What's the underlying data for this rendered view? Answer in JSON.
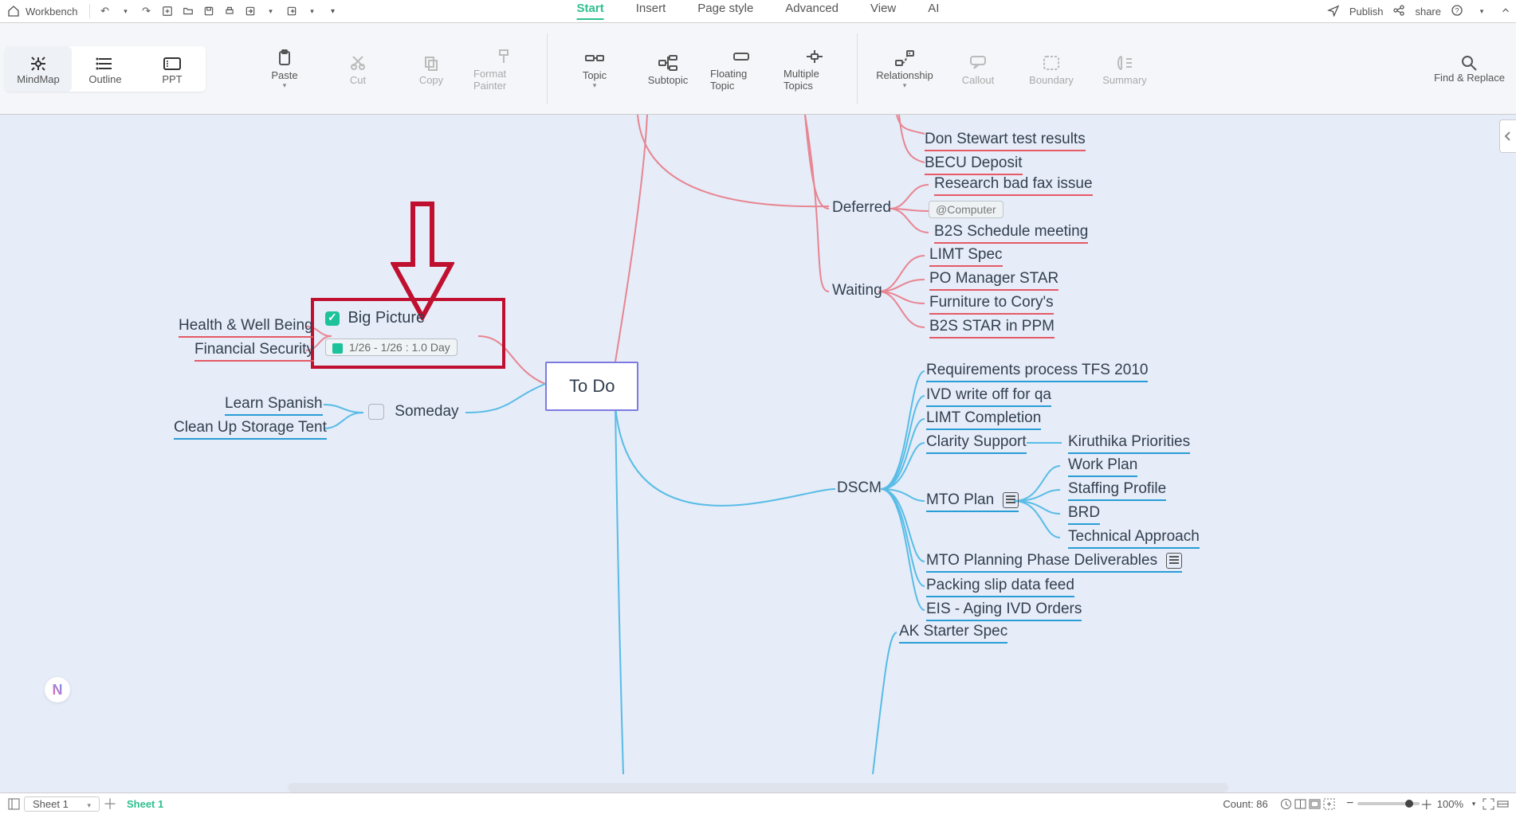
{
  "top": {
    "workbench": "Workbench",
    "menus": [
      "Start",
      "Insert",
      "Page style",
      "Advanced",
      "View",
      "AI"
    ],
    "active_menu": 0,
    "publish": "Publish",
    "share": "share"
  },
  "ribbon": {
    "views": [
      {
        "label": "MindMap",
        "active": true
      },
      {
        "label": "Outline",
        "active": false
      },
      {
        "label": "PPT",
        "active": false
      }
    ],
    "buttons": {
      "paste": "Paste",
      "cut": "Cut",
      "copy": "Copy",
      "format_painter": "Format Painter",
      "topic": "Topic",
      "subtopic": "Subtopic",
      "floating": "Floating Topic",
      "multiple": "Multiple Topics",
      "relationship": "Relationship",
      "callout": "Callout",
      "boundary": "Boundary",
      "summary": "Summary",
      "find_replace": "Find & Replace"
    }
  },
  "central": {
    "label": "To Do"
  },
  "left_branches": {
    "big_picture": {
      "label": "Big Picture",
      "date_badge": "1/26 - 1/26 : 1.0 Day",
      "children": [
        "Health & Well Being",
        "Financial Security"
      ]
    },
    "someday": {
      "label": "Someday",
      "children": [
        "Learn Spanish",
        "Clean Up Storage Tent"
      ]
    }
  },
  "right_branches": {
    "top_stub": [
      "Don Stewart test results",
      "BECU Deposit"
    ],
    "deferred": {
      "label": "Deferred",
      "children_top": "Research bad fax issue",
      "tag": "@Computer",
      "children_bottom": "B2S Schedule meeting"
    },
    "waiting": {
      "label": "Waiting",
      "children": [
        "LIMT Spec",
        "PO Manager STAR",
        "Furniture to Cory's",
        "B2S STAR in PPM"
      ]
    },
    "dscm": {
      "label": "DSCM",
      "direct": [
        "Requirements process TFS 2010",
        "IVD write off for qa",
        "LIMT Completion",
        "Clarity Support"
      ],
      "kiru": "Kiruthika Priorities",
      "mto_plan": {
        "label": "MTO Plan",
        "note": true,
        "children": [
          "Work Plan",
          "Staffing Profile",
          "BRD",
          "Technical Approach"
        ]
      },
      "after": [
        "MTO Planning Phase Deliverables",
        "Packing slip data feed",
        "EIS - Aging IVD Orders"
      ]
    },
    "ak": "AK Starter Spec"
  },
  "bottom": {
    "sheet_select": "Sheet 1",
    "sheet_tab": "Sheet 1",
    "count": "Count: 86",
    "zoom": "100%"
  }
}
